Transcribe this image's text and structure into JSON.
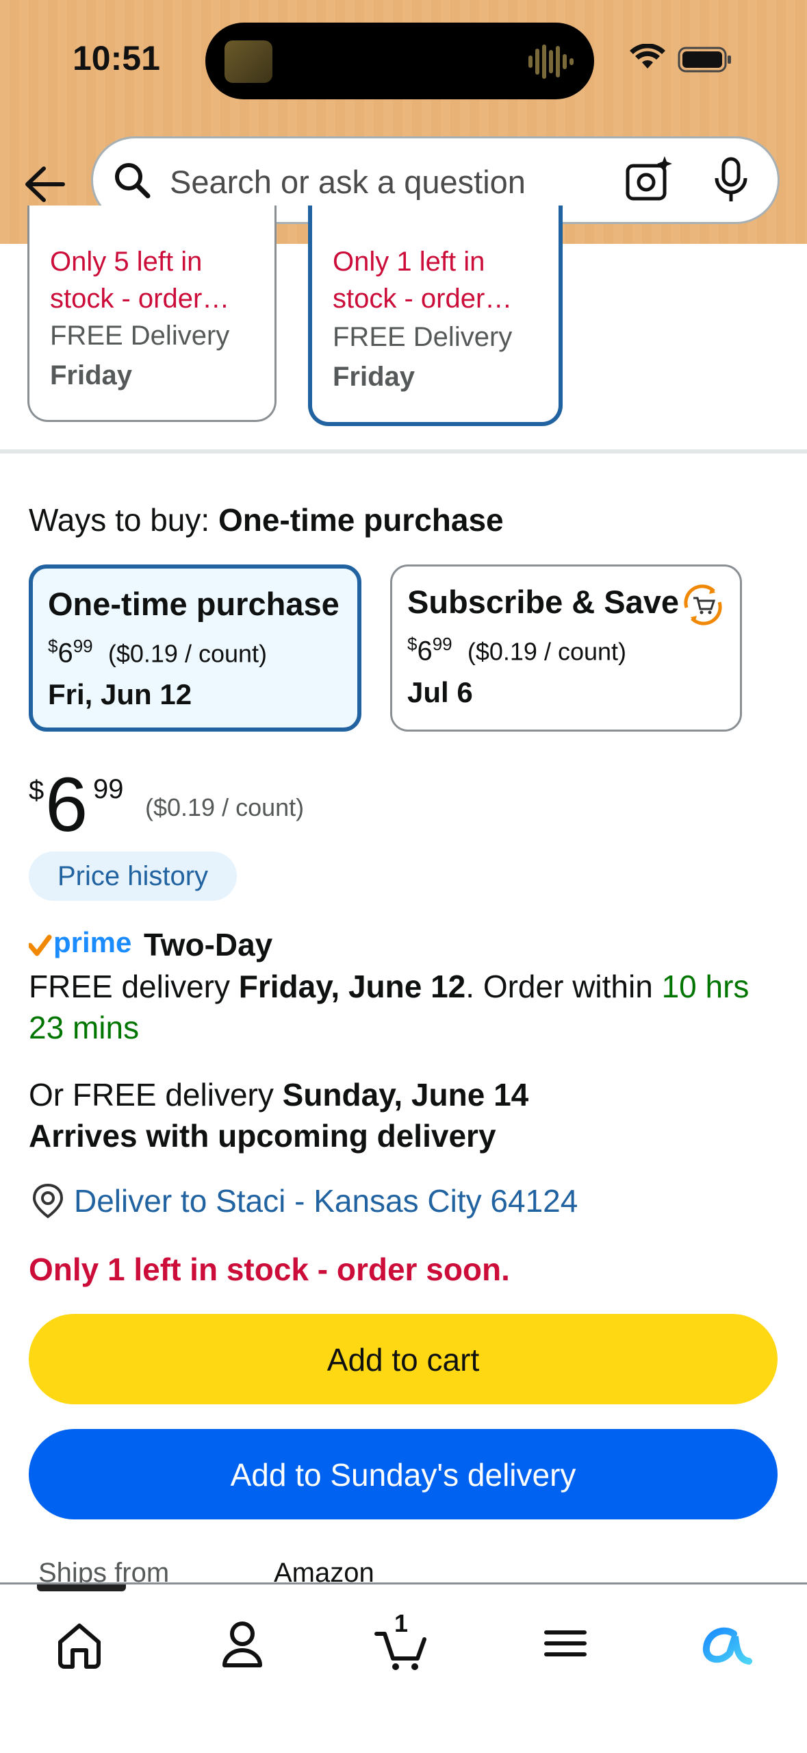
{
  "status_bar": {
    "time": "10:51"
  },
  "search": {
    "placeholder": "Search or ask a question"
  },
  "variants": [
    {
      "stock": "Only 5 left in stock - order…",
      "delivery": "FREE Delivery",
      "day": "Friday"
    },
    {
      "stock": "Only 1 left in stock - order…",
      "delivery": "FREE Delivery",
      "day": "Friday"
    }
  ],
  "ways_to_buy": {
    "label": "Ways to buy:",
    "selected": "One-time purchase",
    "options": [
      {
        "title": "One-time purchase",
        "price_sym": "$",
        "price_whole": "6",
        "price_frac": "99",
        "unit": "($0.19 / count)",
        "date": "Fri, Jun 12"
      },
      {
        "title": "Subscribe & Save",
        "price_sym": "$",
        "price_whole": "6",
        "price_frac": "99",
        "unit": "($0.19 / count)",
        "date": "Jul 6"
      }
    ]
  },
  "price": {
    "symbol": "$",
    "whole": "6",
    "fraction": "99",
    "unit": "($0.19 / count)",
    "history_label": "Price history"
  },
  "delivery": {
    "prime_word": "prime",
    "prime_label": "Two-Day",
    "line_prefix": "FREE delivery ",
    "line_date": "Friday, June 12",
    "line_mid": ". Order within ",
    "countdown": "10 hrs 23 mins",
    "alt_prefix": "Or FREE delivery ",
    "alt_date": "Sunday, June 14",
    "alt_note": "Arrives with upcoming delivery",
    "location": "Deliver to Staci - Kansas City 64124",
    "stock_warning": "Only 1 left in stock - order soon."
  },
  "actions": {
    "add_to_cart": "Add to cart",
    "add_to_sunday": "Add to Sunday's delivery"
  },
  "ships": {
    "label": "Ships from",
    "value": "Amazon"
  },
  "nav": {
    "cart_count": "1"
  },
  "colors": {
    "header": "#ebb67c",
    "primary_blue": "#0062f0",
    "cart_yellow": "#ffd814",
    "stock_red": "#CC0C39",
    "link_blue": "#2162a1",
    "prime_green": "#007600"
  }
}
